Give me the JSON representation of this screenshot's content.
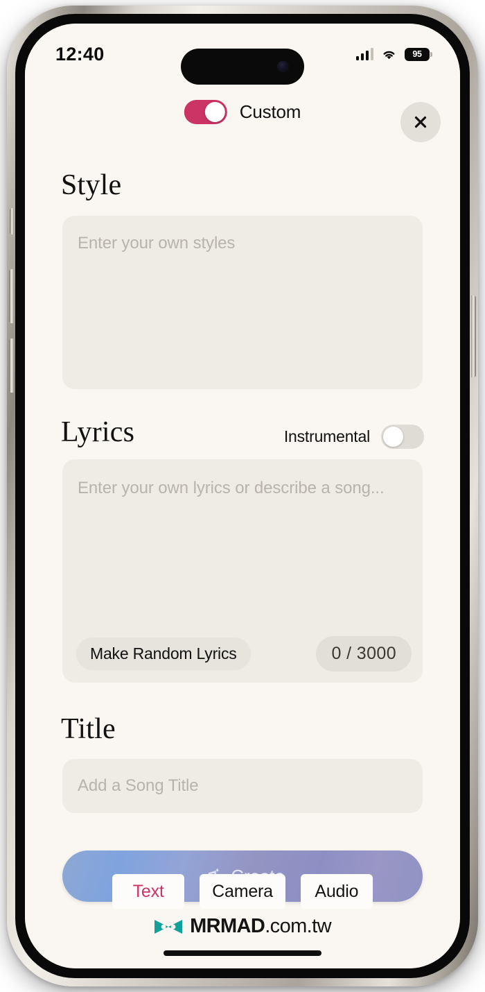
{
  "status_bar": {
    "time": "12:40",
    "battery_level": "95",
    "signal_icon": "cellular-signal-icon",
    "wifi_icon": "wifi-icon",
    "battery_icon": "battery-icon"
  },
  "header": {
    "custom_label": "Custom",
    "custom_toggle_on": true,
    "close_icon": "close-icon"
  },
  "style_section": {
    "heading": "Style",
    "placeholder": "Enter your own styles",
    "value": ""
  },
  "lyrics_section": {
    "heading": "Lyrics",
    "instrumental_label": "Instrumental",
    "instrumental_toggle_on": false,
    "placeholder": "Enter your own lyrics or describe a song...",
    "value": "",
    "random_button_label": "Make Random Lyrics",
    "char_count": "0 / 3000"
  },
  "title_section": {
    "heading": "Title",
    "placeholder": "Add a Song Title",
    "value": ""
  },
  "create_button": {
    "label": "Create",
    "icon": "music-note-sparkle-icon"
  },
  "bottom_tabs": {
    "items": [
      {
        "label": "Text",
        "active": true
      },
      {
        "label": "Camera",
        "active": false
      },
      {
        "label": "Audio",
        "active": false
      }
    ]
  },
  "watermark": {
    "brand": "MRMAD",
    "domain": ".com.tw",
    "logo_icon": "mrmad-bowtie-logo-icon"
  },
  "colors": {
    "accent_pink": "#cb3465",
    "screen_bg": "#faf6f1",
    "field_bg": "#efebe5",
    "toggle_off": "#dfdcd6",
    "create_gradient_start": "#7fa3df",
    "create_gradient_end": "#8f93c2",
    "logo_teal": "#12a19a"
  }
}
